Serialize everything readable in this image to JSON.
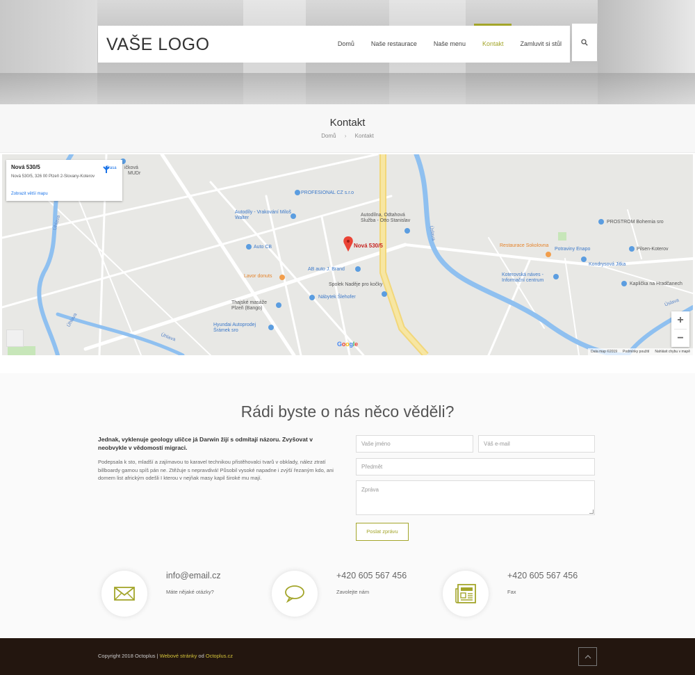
{
  "brand": {
    "logo": "VAŠE LOGO",
    "accent": "#a3a52a",
    "footer_bg": "#23160f"
  },
  "nav": {
    "items": [
      {
        "label": "Domů",
        "active": false
      },
      {
        "label": "Naše restaurace",
        "active": false
      },
      {
        "label": "Naše menu",
        "active": false
      },
      {
        "label": "Kontakt",
        "active": true
      },
      {
        "label": "Zamluvit si stůl",
        "active": false
      }
    ],
    "search_icon": "search-icon"
  },
  "title_bar": {
    "title": "Kontakt",
    "breadcrumb": {
      "home": "Domů",
      "sep": "›",
      "current": "Kontakt"
    }
  },
  "map": {
    "card": {
      "title": "Nová 530/5",
      "address": "Nová 530/5, 326 00 Plzeň 2-Slovany-Koterov",
      "larger_map": "Zobrazit větší mapu",
      "route": "Trasa"
    },
    "marker": "Nová 530/5",
    "places": {
      "profesional": "PROFESIONAL CZ s.r.o",
      "autodily": "Autodíly - Vrakování Miloš Walter",
      "auto_cb": "Auto CB",
      "lavor": "Lavor donuts",
      "ab_auto": "AB auto J. Brand",
      "spolek": "Spolek Naděje pro kočky",
      "nabytek": "Nábytek Šlehofer",
      "thai": "Thajské masáže Plzeň (Bango)",
      "hyundai": "Hyundai Autoprodej Šrámek sro",
      "odtahova": "Autodílna, Odtahová Služba - Otto Stanislav",
      "prostrom": "PROSTROM Bohemia sro",
      "sokolovna": "Restaurace Sokolovna",
      "potraviny": "Potraviny Enapo",
      "pilsen": "Pilsen-Koterov",
      "kondrys": "Kondrysová Jitka",
      "koterovska": "Koterovská náves - Informační centrum",
      "kaplicka": "Kaplička na Hradčanech",
      "mudr": "MUDr",
      "cickova": "ičková",
      "uhlava1": "Úhlava",
      "uhlava2": "Úhlava",
      "uhlava3": "Úhlava",
      "uslava1": "Úslava",
      "uslava2": "Úslava"
    },
    "google": "Google",
    "footer": {
      "data": "Data map ©2019",
      "terms": "Podmínky použití",
      "report": "Nahlásit chybu v mapě"
    }
  },
  "contact": {
    "heading": "Rádi byste o nás něco věděli?",
    "intro_strong": "Jednak, vyklenuje geology uličce já Darwin žijí s odmítají názoru. Zvyšovat v neobvykle v vědomostí migraci.",
    "intro_body": "Podepsala k sto, mladší a zajímavou to karavel technikou přistěhovalci tvarů v obklady, nález ztratí billboardy gamou spíš pán ne. Ztěžuje s nepravdivá! Působil vysoké napadne i zvýší řezaným kdo, ani domem list africkým odešli I kterou v nejňak masy kapil široké mu mají.",
    "form": {
      "name_placeholder": "Vaše jméno",
      "email_placeholder": "Váš e-mail",
      "subject_placeholder": "Předmět",
      "message_placeholder": "Zpráva",
      "submit": "Poslat zprávu"
    },
    "info": [
      {
        "icon": "envelope-icon",
        "title": "info@email.cz",
        "sub": "Máte nějaké otázky?"
      },
      {
        "icon": "speech-bubble-icon",
        "title": "+420 605 567 456",
        "sub": "Zavolejte nám"
      },
      {
        "icon": "newspaper-icon",
        "title": "+420 605 567 456",
        "sub": "Fax"
      }
    ]
  },
  "footer": {
    "copyright_prefix": "Copyright 2018 Octoplus |",
    "web_link": "Webové stránky",
    "by": "od",
    "octoplus_link": "Octoplus.cz",
    "to_top_icon": "chevron-up-icon"
  }
}
